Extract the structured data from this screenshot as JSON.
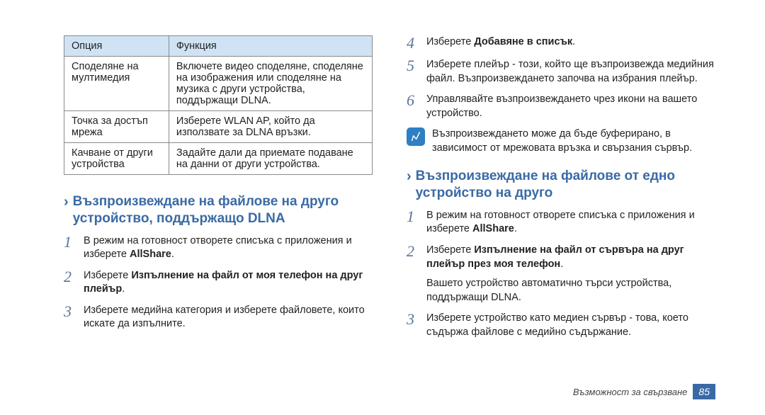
{
  "table": {
    "headers": {
      "c1": "Опция",
      "c2": "Функция"
    },
    "rows": [
      {
        "c1": "Споделяне на мултимедия",
        "c2": "Включете видео споделяне, споделяне на изображения или споделяне на музика с други устройства, поддържащи DLNA."
      },
      {
        "c1": "Точка за достъп мрежа",
        "c2": "Изберете WLAN AP, който да използвате за DLNA връзки."
      },
      {
        "c1": "Качване от други устройства",
        "c2": "Задайте дали да приемате подаване на данни от други устройства."
      }
    ]
  },
  "left": {
    "heading": "Възпроизвеждане на файлове на друго устройство, поддържащо DLNA",
    "steps": [
      {
        "n": "1",
        "t_pre": "В режим на готовност отворете списъка с приложения и изберете ",
        "t_bold": "AllShare",
        "t_post": "."
      },
      {
        "n": "2",
        "t_pre": "Изберете ",
        "t_bold": "Изпълнение на файл от моя телефон на друг плейър",
        "t_post": "."
      },
      {
        "n": "3",
        "t_pre": "Изберете медийна категория и изберете файловете, които искате да изпълните.",
        "t_bold": "",
        "t_post": ""
      }
    ]
  },
  "right": {
    "steps_top": [
      {
        "n": "4",
        "t_pre": "Изберете ",
        "t_bold": "Добавяне в списък",
        "t_post": "."
      },
      {
        "n": "5",
        "t_pre": "Изберете плейър - този, който ще възпроизвежда медийния файл. Възпроизвеждането започва на избрания плейър.",
        "t_bold": "",
        "t_post": ""
      },
      {
        "n": "6",
        "t_pre": "Управлявайте възпроизвеждането чрез икони на вашето устройство.",
        "t_bold": "",
        "t_post": ""
      }
    ],
    "note_text": "Възпроизвеждането може да бъде буферирано, в зависимост от мрежовата връзка и свързания сървър.",
    "heading2": "Възпроизвеждане на файлове от едно устройство на друго",
    "steps_bottom": [
      {
        "n": "1",
        "t_pre": "В режим на готовност отворете списъка с приложения и изберете ",
        "t_bold": "AllShare",
        "t_post": "."
      },
      {
        "n": "2",
        "t_pre": "Изберете ",
        "t_bold": "Изпълнение на файл от сървъра на друг плейър през моя телефон",
        "t_post": ".",
        "t_extra": "Вашето устройство автоматично търси устройства, поддържащи DLNA."
      },
      {
        "n": "3",
        "t_pre": "Изберете устройство като медиен сървър - това, което съдържа файлове с медийно съдържание.",
        "t_bold": "",
        "t_post": ""
      }
    ]
  },
  "footer": {
    "label": "Възможност за свързване",
    "page": "85"
  }
}
